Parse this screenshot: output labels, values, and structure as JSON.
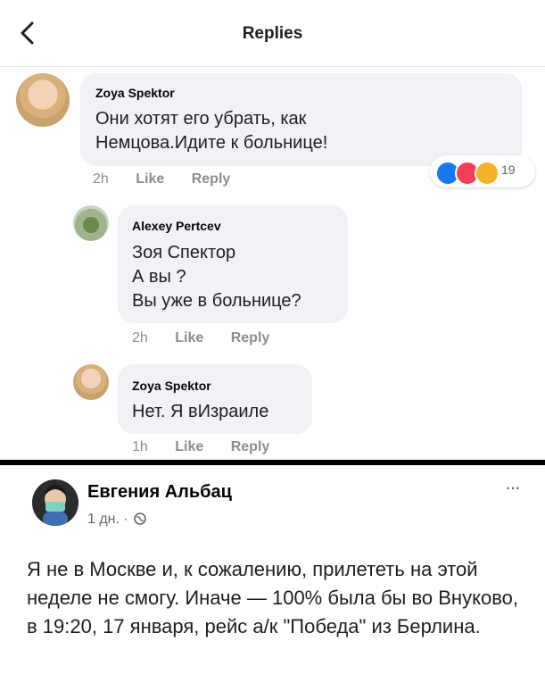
{
  "header": {
    "title": "Replies"
  },
  "comments": [
    {
      "author": "Zoya Spektor",
      "text": "Они хотят его убрать, как\nНемцова.Идите к больнице!",
      "time": "2h",
      "like": "Like",
      "reply": "Reply",
      "reactions": {
        "count": "19",
        "icons": [
          "like-icon",
          "love-icon",
          "haha-icon"
        ]
      }
    },
    {
      "author": "Alexey Pertcev",
      "text": "Зоя Спектор\nА вы ?\nВы уже в больнице?",
      "time": "2h",
      "like": "Like",
      "reply": "Reply"
    },
    {
      "author": "Zoya Spektor",
      "text": "Нет. Я вИзраиле",
      "time": "1h",
      "like": "Like",
      "reply": "Reply"
    }
  ],
  "post": {
    "author": "Евгения Альбац",
    "time": "1 дн. ·",
    "more": "···",
    "text": "Я не в Москве и, к сожалению, прилететь на этой неделе не смогу. Иначе — 100% была бы во Внуково, в 19:20, 17 января, рейс  а/к \"Победа\" из Берлина."
  },
  "colors": {
    "accent_like": "#1877f2",
    "accent_love": "#f33e58",
    "accent_haha": "#f7b125",
    "bubble": "#f0f2f5",
    "meta": "#8a8d91"
  }
}
